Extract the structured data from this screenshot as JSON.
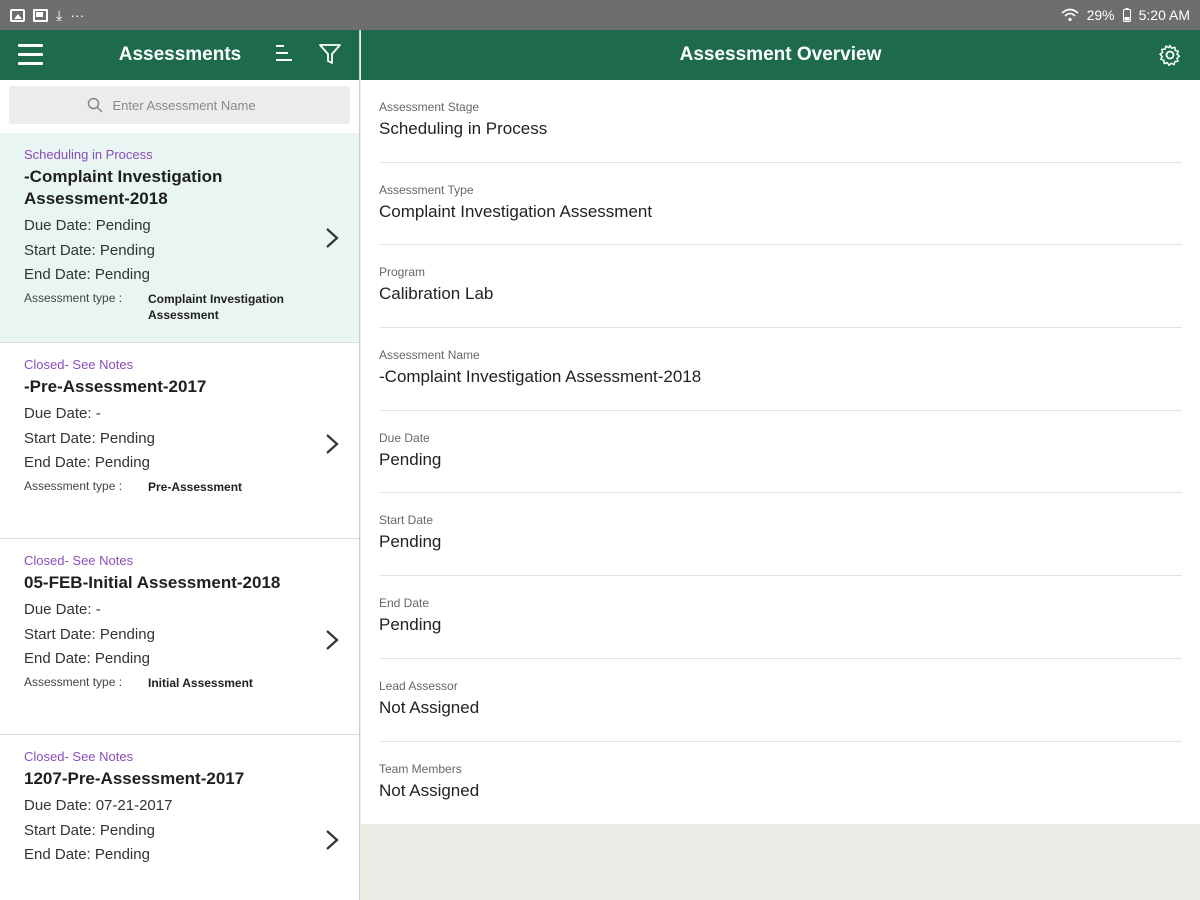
{
  "status_bar": {
    "left_icons": [
      "gallery-icon",
      "message-icon",
      "download-icon",
      "more-icon"
    ],
    "more": "···",
    "battery": "29%",
    "time": "5:20 AM"
  },
  "colors": {
    "appbar": "#1d6b4c",
    "stage_text": "#8b4dbb",
    "active_row": "#e8f5f3"
  },
  "left_panel": {
    "title": "Assessments",
    "search_placeholder": "Enter Assessment Name",
    "items": [
      {
        "stage": "Scheduling in Process",
        "title": "-Complaint Investigation Assessment-2018",
        "due": "Due Date: Pending",
        "start": "Start Date: Pending",
        "end": "End Date: Pending",
        "type_label": "Assessment type :",
        "type_value": "Complaint Investigation Assessment",
        "active": true
      },
      {
        "stage": "Closed- See Notes",
        "title": "-Pre-Assessment-2017",
        "due": "Due Date: -",
        "start": "Start Date: Pending",
        "end": "End Date: Pending",
        "type_label": "Assessment type :",
        "type_value": "Pre-Assessment",
        "active": false
      },
      {
        "stage": "Closed- See Notes",
        "title": "05-FEB-Initial Assessment-2018",
        "due": "Due Date: -",
        "start": "Start Date: Pending",
        "end": "End Date: Pending",
        "type_label": "Assessment type :",
        "type_value": "Initial Assessment",
        "active": false
      },
      {
        "stage": "Closed- See Notes",
        "title": "1207-Pre-Assessment-2017",
        "due": "Due Date: 07-21-2017",
        "start": "Start Date: Pending",
        "end": "End Date: Pending",
        "active": false
      }
    ]
  },
  "overview": {
    "title": "Assessment Overview",
    "fields": [
      {
        "label": "Assessment Stage",
        "value": "Scheduling in Process"
      },
      {
        "label": "Assessment Type",
        "value": "Complaint Investigation Assessment"
      },
      {
        "label": "Program",
        "value": "Calibration Lab"
      },
      {
        "label": "Assessment Name",
        "value": "-Complaint Investigation Assessment-2018"
      },
      {
        "label": "Due Date",
        "value": "Pending"
      },
      {
        "label": "Start Date",
        "value": "Pending"
      },
      {
        "label": "End Date",
        "value": "Pending"
      },
      {
        "label": "Lead Assessor",
        "value": "Not Assigned"
      },
      {
        "label": "Team Members",
        "value": "Not Assigned"
      }
    ]
  }
}
